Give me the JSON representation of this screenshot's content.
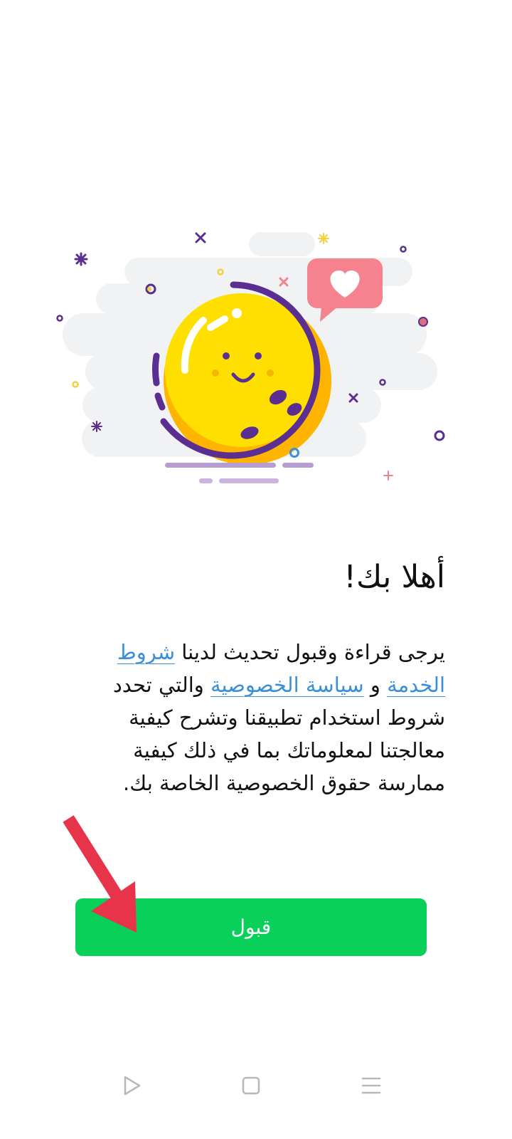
{
  "welcome": {
    "title": "أهلا بك!",
    "body_prefix": "يرجى قراءة وقبول تحديث لدينا ",
    "terms_link": "شروط الخدمة",
    "conjunction": " و ",
    "privacy_link": "سياسة الخصوصية",
    "body_suffix": " والتي تحدد شروط استخدام تطبيقنا وتشرح كيفية معالجتنا لمعلوماتك بما في ذلك كيفية ممارسة حقوق الخصوصية الخاصة بك."
  },
  "accept_button": {
    "label": "قبول"
  },
  "illustration": {
    "name": "smiling-coin-with-heart-illustration"
  },
  "navigation": {
    "back_icon": "triangle-back-icon",
    "home_icon": "square-home-icon",
    "menu_icon": "three-lines-menu-icon"
  },
  "colors": {
    "accent_green": "#08d058",
    "link_blue": "#3b8fd9",
    "arrow_red": "#e8344a"
  }
}
